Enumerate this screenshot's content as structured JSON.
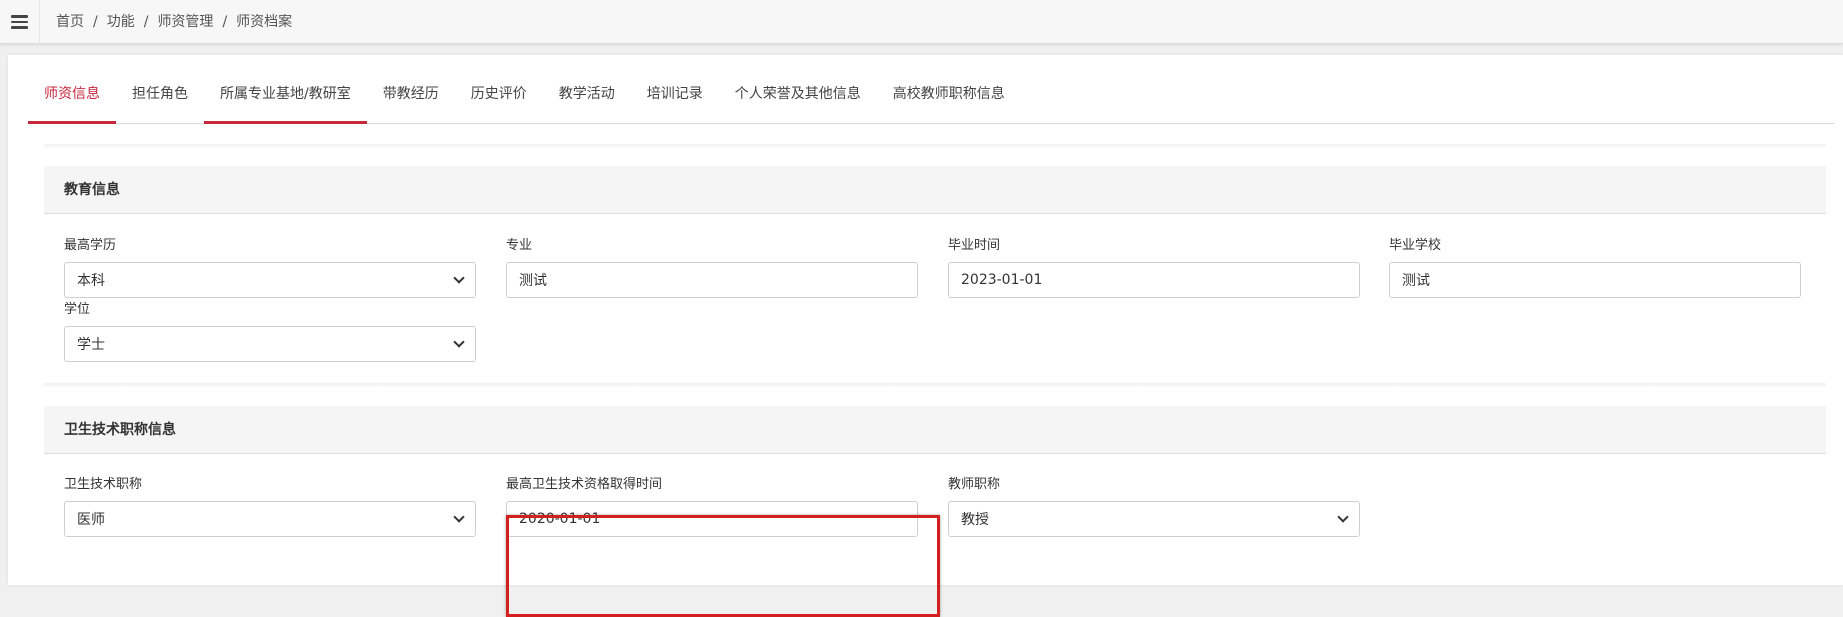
{
  "breadcrumb": [
    "首页",
    "功能",
    "师资管理",
    "师资档案"
  ],
  "breadcrumb_separator": "/",
  "tabs": [
    {
      "label": "师资信息"
    },
    {
      "label": "担任角色"
    },
    {
      "label": "所属专业基地/教研室"
    },
    {
      "label": "带教经历"
    },
    {
      "label": "历史评价"
    },
    {
      "label": "教学活动"
    },
    {
      "label": "培训记录"
    },
    {
      "label": "个人荣誉及其他信息"
    },
    {
      "label": "高校教师职称信息"
    }
  ],
  "education": {
    "title": "教育信息",
    "highest_degree": {
      "label": "最高学历",
      "value": "本科"
    },
    "major": {
      "label": "专业",
      "value": "测试"
    },
    "graduation_date": {
      "label": "毕业时间",
      "value": "2023-01-01"
    },
    "graduation_school": {
      "label": "毕业学校",
      "value": "测试"
    },
    "academic_degree": {
      "label": "学位",
      "value": "学士"
    }
  },
  "health_title": {
    "title": "卫生技术职称信息",
    "tech_title": {
      "label": "卫生技术职称",
      "value": "医师"
    },
    "qualification_date": {
      "label": "最高卫生技术资格取得时间",
      "value": "2020-01-01"
    },
    "teacher_title": {
      "label": "教师职称",
      "value": "教授"
    }
  },
  "colors": {
    "accent": "#c8273c",
    "highlight_border": "#d21f1f"
  }
}
